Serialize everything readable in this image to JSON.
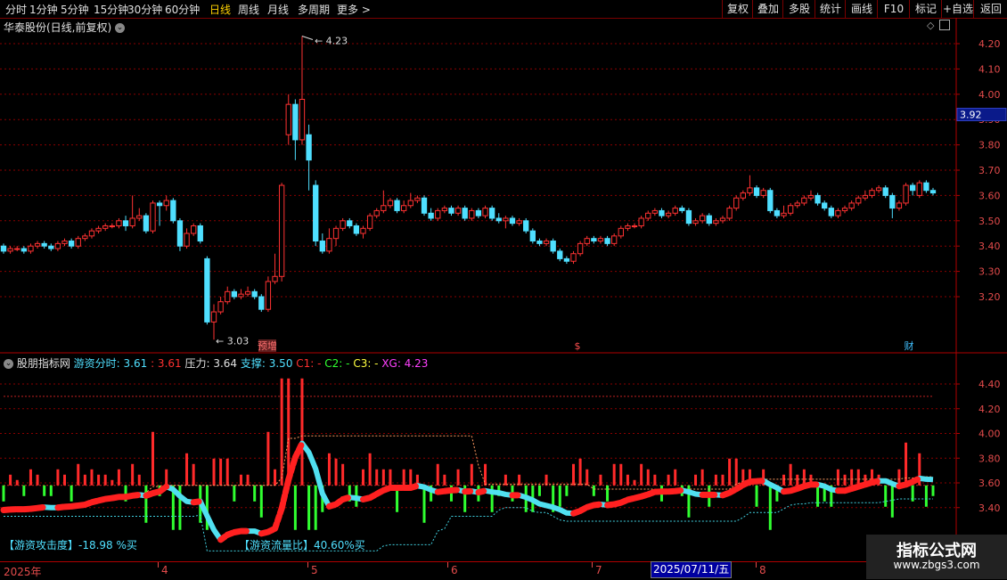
{
  "toolbar": {
    "periods": [
      "分时",
      "1分钟",
      "5分钟",
      "15分钟",
      "30分钟",
      "60分钟",
      "日线",
      "周线",
      "月线",
      "多周期",
      "更多 >"
    ],
    "selected": "日线",
    "buttons": [
      "复权",
      "叠加",
      "多股",
      "统计",
      "画线",
      "F10",
      "标记",
      "+自选",
      "返回"
    ]
  },
  "main": {
    "title": "华泰股份(日线,前复权)",
    "price_tag": "3.92",
    "high_label": "4.23",
    "low_label": "3.03",
    "markers": [
      "预增",
      "$",
      "财"
    ]
  },
  "indicator": {
    "name": "股朋指标网",
    "values": [
      {
        "label": "游资分时: 3.61",
        "color": "#50e0ff"
      },
      {
        "label": ": 3.61",
        "color": "#ff3030"
      },
      {
        "label": "压力: 3.64",
        "color": "#e0e0e0"
      },
      {
        "label": "支撑: 3.50",
        "color": "#50e0ff"
      },
      {
        "label": "C1: -",
        "color": "#ff3030"
      },
      {
        "label": "C2: -",
        "color": "#30ff30"
      },
      {
        "label": "C3: -",
        "color": "#ffff40"
      },
      {
        "label": "XG: 4.23",
        "color": "#ff40ff"
      }
    ],
    "attack": "【游资攻击度】-18.98 %买",
    "flow": "【游资流量比】40.60%买"
  },
  "axis": {
    "main_ticks": [
      "4.20",
      "4.10",
      "4.00",
      "3.90",
      "3.80",
      "3.70",
      "3.60",
      "3.50",
      "3.40",
      "3.30",
      "3.20"
    ],
    "ind_ticks": [
      "4.40",
      "4.20",
      "4.00",
      "3.80",
      "3.60",
      "3.40"
    ],
    "dates": [
      "2025年",
      "4",
      "5",
      "6",
      "7",
      "8"
    ],
    "cursor_date": "2025/07/11/五"
  },
  "watermark": {
    "title": "指标公式网",
    "url": "www.zbgs3.com"
  },
  "colors": {
    "up": "#ff3232",
    "down": "#4fdfff",
    "grid": "#8a0000",
    "dashed_red": "#c02020"
  },
  "chart_data": {
    "type": "candlestick",
    "title": "华泰股份(日线,前复权)",
    "ylim": [
      3.03,
      4.25
    ],
    "candles": [
      [
        3.4,
        3.38,
        3.41,
        3.37
      ],
      [
        3.38,
        3.39,
        3.4,
        3.37
      ],
      [
        3.39,
        3.39,
        3.4,
        3.38
      ],
      [
        3.39,
        3.38,
        3.4,
        3.37
      ],
      [
        3.38,
        3.4,
        3.41,
        3.37
      ],
      [
        3.4,
        3.41,
        3.42,
        3.39
      ],
      [
        3.41,
        3.4,
        3.42,
        3.39
      ],
      [
        3.4,
        3.39,
        3.41,
        3.38
      ],
      [
        3.39,
        3.41,
        3.42,
        3.38
      ],
      [
        3.41,
        3.42,
        3.43,
        3.4
      ],
      [
        3.42,
        3.4,
        3.43,
        3.39
      ],
      [
        3.4,
        3.43,
        3.44,
        3.39
      ],
      [
        3.43,
        3.44,
        3.45,
        3.42
      ],
      [
        3.44,
        3.46,
        3.47,
        3.43
      ],
      [
        3.46,
        3.47,
        3.48,
        3.45
      ],
      [
        3.47,
        3.48,
        3.49,
        3.46
      ],
      [
        3.48,
        3.48,
        3.49,
        3.47
      ],
      [
        3.48,
        3.5,
        3.51,
        3.47
      ],
      [
        3.5,
        3.48,
        3.52,
        3.46
      ],
      [
        3.48,
        3.51,
        3.6,
        3.47
      ],
      [
        3.51,
        3.52,
        3.55,
        3.5
      ],
      [
        3.52,
        3.46,
        3.53,
        3.45
      ],
      [
        3.46,
        3.57,
        3.58,
        3.45
      ],
      [
        3.57,
        3.56,
        3.58,
        3.48
      ],
      [
        3.56,
        3.58,
        3.6,
        3.54
      ],
      [
        3.58,
        3.5,
        3.59,
        3.49
      ],
      [
        3.5,
        3.4,
        3.51,
        3.38
      ],
      [
        3.4,
        3.45,
        3.47,
        3.39
      ],
      [
        3.45,
        3.48,
        3.49,
        3.44
      ],
      [
        3.48,
        3.42,
        3.49,
        3.41
      ],
      [
        3.35,
        3.1,
        3.36,
        3.09
      ],
      [
        3.1,
        3.14,
        3.17,
        3.03
      ],
      [
        3.14,
        3.18,
        3.2,
        3.13
      ],
      [
        3.18,
        3.22,
        3.24,
        3.17
      ],
      [
        3.22,
        3.2,
        3.23,
        3.19
      ],
      [
        3.2,
        3.21,
        3.23,
        3.19
      ],
      [
        3.21,
        3.22,
        3.24,
        3.2
      ],
      [
        3.22,
        3.2,
        3.23,
        3.19
      ],
      [
        3.2,
        3.15,
        3.21,
        3.14
      ],
      [
        3.15,
        3.26,
        3.28,
        3.14
      ],
      [
        3.26,
        3.28,
        3.37,
        3.25
      ],
      [
        3.28,
        3.64,
        3.65,
        3.26
      ],
      [
        3.84,
        3.96,
        4.0,
        3.8
      ],
      [
        3.96,
        3.82,
        3.98,
        3.74
      ],
      [
        3.82,
        3.98,
        4.23,
        3.8
      ],
      [
        3.84,
        3.74,
        3.88,
        3.62
      ],
      [
        3.64,
        3.42,
        3.66,
        3.4
      ],
      [
        3.42,
        3.38,
        3.45,
        3.37
      ],
      [
        3.38,
        3.43,
        3.47,
        3.37
      ],
      [
        3.43,
        3.47,
        3.48,
        3.4
      ],
      [
        3.47,
        3.5,
        3.51,
        3.46
      ],
      [
        3.5,
        3.48,
        3.51,
        3.47
      ],
      [
        3.48,
        3.45,
        3.49,
        3.44
      ],
      [
        3.45,
        3.47,
        3.48,
        3.43
      ],
      [
        3.47,
        3.52,
        3.53,
        3.46
      ],
      [
        3.52,
        3.54,
        3.55,
        3.51
      ],
      [
        3.54,
        3.56,
        3.62,
        3.53
      ],
      [
        3.56,
        3.58,
        3.59,
        3.55
      ],
      [
        3.58,
        3.54,
        3.59,
        3.53
      ],
      [
        3.54,
        3.56,
        3.58,
        3.53
      ],
      [
        3.56,
        3.58,
        3.61,
        3.55
      ],
      [
        3.58,
        3.59,
        3.6,
        3.57
      ],
      [
        3.59,
        3.53,
        3.6,
        3.52
      ],
      [
        3.53,
        3.51,
        3.55,
        3.5
      ],
      [
        3.51,
        3.54,
        3.55,
        3.5
      ],
      [
        3.54,
        3.55,
        3.56,
        3.53
      ],
      [
        3.55,
        3.53,
        3.56,
        3.52
      ],
      [
        3.53,
        3.55,
        3.56,
        3.52
      ],
      [
        3.55,
        3.51,
        3.56,
        3.5
      ],
      [
        3.51,
        3.54,
        3.55,
        3.5
      ],
      [
        3.54,
        3.52,
        3.55,
        3.51
      ],
      [
        3.52,
        3.55,
        3.56,
        3.51
      ],
      [
        3.55,
        3.51,
        3.56,
        3.5
      ],
      [
        3.51,
        3.5,
        3.53,
        3.49
      ],
      [
        3.5,
        3.51,
        3.52,
        3.47
      ],
      [
        3.51,
        3.49,
        3.52,
        3.48
      ],
      [
        3.49,
        3.5,
        3.51,
        3.48
      ],
      [
        3.5,
        3.46,
        3.51,
        3.45
      ],
      [
        3.46,
        3.42,
        3.47,
        3.41
      ],
      [
        3.42,
        3.41,
        3.43,
        3.4
      ],
      [
        3.41,
        3.42,
        3.43,
        3.4
      ],
      [
        3.42,
        3.38,
        3.43,
        3.37
      ],
      [
        3.38,
        3.35,
        3.39,
        3.34
      ],
      [
        3.35,
        3.34,
        3.36,
        3.33
      ],
      [
        3.34,
        3.37,
        3.38,
        3.33
      ],
      [
        3.37,
        3.41,
        3.42,
        3.36
      ],
      [
        3.41,
        3.43,
        3.44,
        3.4
      ],
      [
        3.43,
        3.42,
        3.44,
        3.41
      ],
      [
        3.42,
        3.43,
        3.44,
        3.41
      ],
      [
        3.43,
        3.41,
        3.44,
        3.4
      ],
      [
        3.41,
        3.44,
        3.45,
        3.4
      ],
      [
        3.44,
        3.47,
        3.48,
        3.43
      ],
      [
        3.47,
        3.48,
        3.49,
        3.46
      ],
      [
        3.48,
        3.48,
        3.49,
        3.47
      ],
      [
        3.48,
        3.51,
        3.52,
        3.47
      ],
      [
        3.51,
        3.53,
        3.54,
        3.5
      ],
      [
        3.53,
        3.54,
        3.55,
        3.52
      ],
      [
        3.54,
        3.52,
        3.55,
        3.51
      ],
      [
        3.52,
        3.53,
        3.54,
        3.51
      ],
      [
        3.53,
        3.55,
        3.56,
        3.52
      ],
      [
        3.55,
        3.54,
        3.56,
        3.53
      ],
      [
        3.54,
        3.49,
        3.55,
        3.48
      ],
      [
        3.49,
        3.5,
        3.51,
        3.48
      ],
      [
        3.5,
        3.52,
        3.53,
        3.49
      ],
      [
        3.52,
        3.49,
        3.53,
        3.48
      ],
      [
        3.49,
        3.5,
        3.51,
        3.48
      ],
      [
        3.5,
        3.51,
        3.52,
        3.49
      ],
      [
        3.51,
        3.55,
        3.56,
        3.5
      ],
      [
        3.55,
        3.59,
        3.6,
        3.54
      ],
      [
        3.59,
        3.61,
        3.62,
        3.58
      ],
      [
        3.61,
        3.63,
        3.68,
        3.6
      ],
      [
        3.63,
        3.6,
        3.64,
        3.59
      ],
      [
        3.6,
        3.62,
        3.63,
        3.59
      ],
      [
        3.62,
        3.54,
        3.63,
        3.53
      ],
      [
        3.54,
        3.52,
        3.55,
        3.51
      ],
      [
        3.52,
        3.53,
        3.56,
        3.51
      ],
      [
        3.53,
        3.56,
        3.57,
        3.52
      ],
      [
        3.56,
        3.57,
        3.58,
        3.55
      ],
      [
        3.57,
        3.59,
        3.6,
        3.56
      ],
      [
        3.59,
        3.6,
        3.62,
        3.58
      ],
      [
        3.6,
        3.57,
        3.61,
        3.56
      ],
      [
        3.57,
        3.55,
        3.58,
        3.54
      ],
      [
        3.55,
        3.52,
        3.56,
        3.51
      ],
      [
        3.52,
        3.54,
        3.55,
        3.51
      ],
      [
        3.54,
        3.55,
        3.56,
        3.53
      ],
      [
        3.55,
        3.57,
        3.58,
        3.54
      ],
      [
        3.57,
        3.59,
        3.6,
        3.56
      ],
      [
        3.59,
        3.6,
        3.62,
        3.58
      ],
      [
        3.6,
        3.62,
        3.63,
        3.59
      ],
      [
        3.62,
        3.63,
        3.64,
        3.61
      ],
      [
        3.63,
        3.6,
        3.64,
        3.59
      ],
      [
        3.6,
        3.55,
        3.61,
        3.51
      ],
      [
        3.55,
        3.57,
        3.58,
        3.54
      ],
      [
        3.57,
        3.64,
        3.65,
        3.56
      ],
      [
        3.64,
        3.62,
        3.65,
        3.6
      ],
      [
        3.6,
        3.65,
        3.66,
        3.59
      ],
      [
        3.65,
        3.62,
        3.66,
        3.61
      ],
      [
        3.62,
        3.61,
        3.63,
        3.6
      ]
    ],
    "indicator_series": [
      {
        "name": "游资分时",
        "last": 3.61
      },
      {
        "name": "压力",
        "last": 3.64
      },
      {
        "name": "支撑",
        "last": 3.5
      }
    ]
  }
}
